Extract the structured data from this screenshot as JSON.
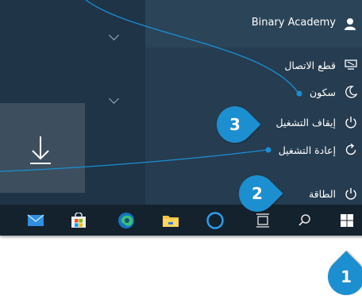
{
  "account": {
    "name": "Binary Academy",
    "icon": "user-icon"
  },
  "power_menu": {
    "disconnect_label": "قطع الاتصال",
    "sleep_label": "سكون",
    "shutdown_label": "إيقاف التشغيل",
    "restart_label": "إعادة التشغيل"
  },
  "power_button": {
    "label": "الطاقة"
  },
  "left_tile": {
    "icon": "download-icon"
  },
  "taskbar": {
    "icons": [
      "start-icon",
      "search-icon",
      "task-view-icon",
      "cortana-icon",
      "file-explorer-icon",
      "edge-icon",
      "store-icon",
      "mail-icon"
    ]
  },
  "callouts": {
    "one": "1",
    "two": "2",
    "three": "3"
  },
  "colors": {
    "callout": "#1c8fd0",
    "connector": "#1a8fd4",
    "menu_bg": "#263c50",
    "taskbar_bg": "#14222e"
  }
}
